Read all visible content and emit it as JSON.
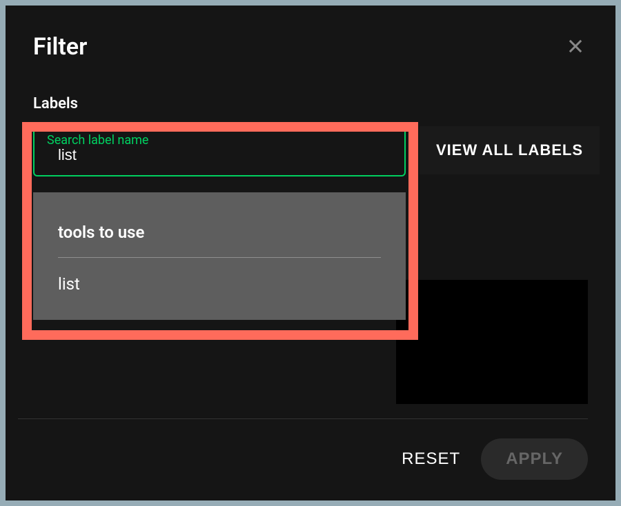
{
  "modal": {
    "title": "Filter"
  },
  "labels": {
    "section_title": "Labels",
    "search_label": "Search label name",
    "search_value": "list",
    "view_all_button": "VIEW ALL LABELS"
  },
  "dropdown": {
    "items": [
      "tools to use",
      "list"
    ]
  },
  "footer": {
    "reset_label": "RESET",
    "apply_label": "APPLY"
  }
}
